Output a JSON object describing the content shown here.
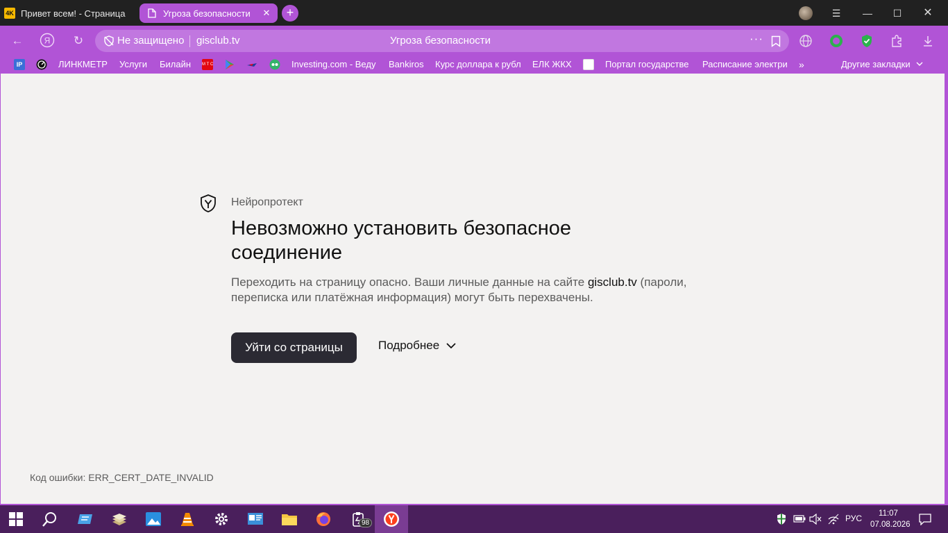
{
  "tabs": [
    {
      "title": "Привет всем! - Страница",
      "favicon": "4K",
      "active": false
    },
    {
      "title": "Угроза безопасности",
      "active": true
    }
  ],
  "omnibox": {
    "security_label": "Не защищено",
    "url": "gisclub.tv",
    "page_title": "Угроза безопасности"
  },
  "bookmarks": {
    "items": [
      "ЛИНКМЕТР",
      "Услуги",
      "Билайн",
      "Investing.com - Веду",
      "Bankiros",
      "Курс доллара к рубл",
      "ЕЛК ЖКХ",
      "Портал государстве",
      "Расписание электри"
    ],
    "other_label": "Другие закладки",
    "icon_labels": {
      "ip": "IP",
      "mts": "М Т С"
    }
  },
  "warning": {
    "brand": "Нейропротект",
    "title": "Невозможно установить безопасное соединение",
    "desc_prefix": "Переходить на страницу опасно. Ваши личные данные на сайте ",
    "desc_host": "gisclub.tv",
    "desc_suffix": " (пароли, переписка или платёжная информация) могут быть перехвачены.",
    "leave_button": "Уйти со страницы",
    "more_button": "Подробнее",
    "error_code": "Код ошибки: ERR_CERT_DATE_INVALID"
  },
  "taskbar": {
    "badge": "98",
    "language": "РУС",
    "time": "11:07",
    "date": "07.08.2026"
  },
  "colors": {
    "accent": "#b154d6",
    "page_bg": "#f3f2f1",
    "button_dark": "#2b2a33",
    "taskbar": "#4a1f5c"
  }
}
